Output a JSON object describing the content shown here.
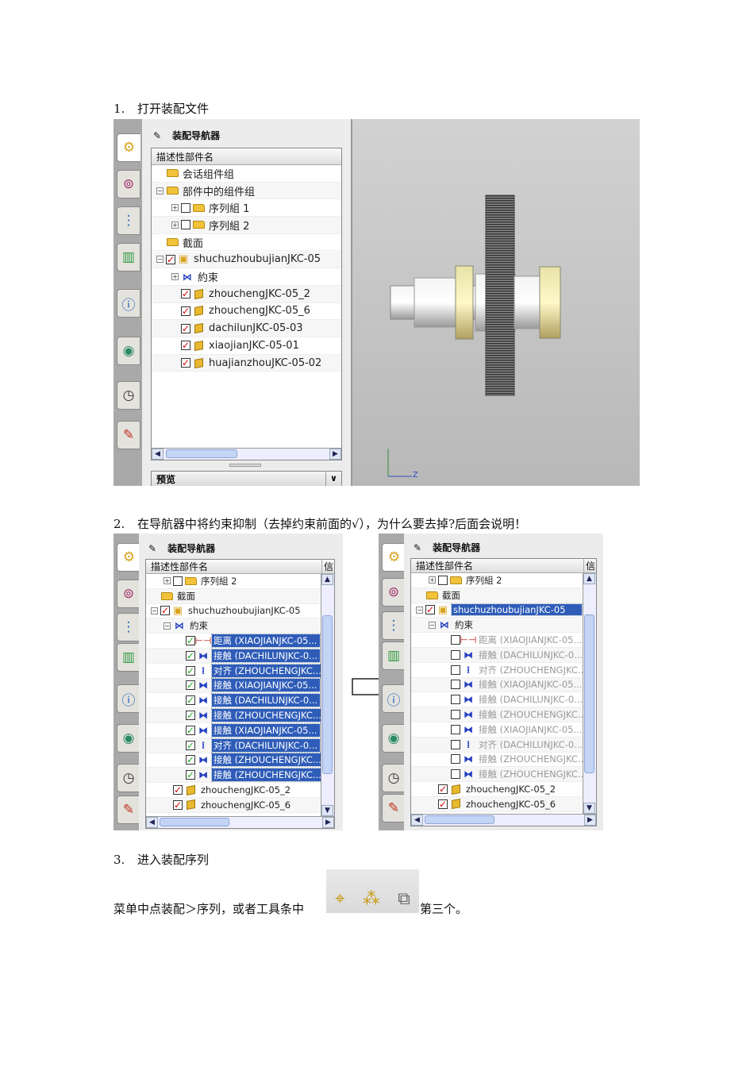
{
  "steps": [
    {
      "num": "1.",
      "text": "打开装配文件"
    },
    {
      "num": "2.",
      "text": "在导航器中将约束抑制（去掉约束前面的√），为什么要去掉?后面会说明！"
    },
    {
      "num": "3.",
      "text": "进入装配序列"
    }
  ],
  "line3": {
    "before": "菜单中点装配＞序列，或者工具条中",
    "after": "第三个。"
  },
  "colors": {
    "selection": "#2e5cb8",
    "check_red": "#dd0000",
    "check_green": "#22aa22",
    "viewport": "#c4c4c4"
  },
  "nav1": {
    "title": "装配导航器",
    "column": "描述性部件名",
    "preview": "预览",
    "axis_label": "Z",
    "rows": [
      {
        "level": 0,
        "exp": "",
        "check": "",
        "icon": "folder",
        "label": "会话组件组"
      },
      {
        "level": 0,
        "exp": "-",
        "check": "",
        "icon": "folder",
        "label": "部件中的组件组"
      },
      {
        "level": 1,
        "exp": "+",
        "check": "empty",
        "icon": "folder",
        "label": "序列組 1"
      },
      {
        "level": 1,
        "exp": "+",
        "check": "empty",
        "icon": "folder",
        "label": "序列組 2"
      },
      {
        "level": 0,
        "exp": "",
        "check": "",
        "icon": "folder",
        "label": "截面"
      },
      {
        "level": 0,
        "exp": "-",
        "check": "red",
        "icon": "assembly",
        "label": "shuchuzhoubujianJKC-05"
      },
      {
        "level": 1,
        "exp": "+",
        "check": "",
        "icon": "constraint",
        "label": "約束"
      },
      {
        "level": 1,
        "exp": "",
        "check": "red",
        "icon": "part",
        "label": "zhouchengJKC-05_2"
      },
      {
        "level": 1,
        "exp": "",
        "check": "red",
        "icon": "part",
        "label": "zhouchengJKC-05_6"
      },
      {
        "level": 1,
        "exp": "",
        "check": "red",
        "icon": "part",
        "label": "dachilunJKC-05-03"
      },
      {
        "level": 1,
        "exp": "",
        "check": "red",
        "icon": "part",
        "label": "xiaojianJKC-05-01"
      },
      {
        "level": 1,
        "exp": "",
        "check": "red",
        "icon": "part",
        "label": "huajianzhouJKC-05-02"
      }
    ]
  },
  "nav2": {
    "title": "装配导航器",
    "column": "描述性部件名",
    "column2": "信.",
    "rows": [
      {
        "level": 1,
        "exp": "+",
        "check": "empty",
        "icon": "folder",
        "label": "序列組 2"
      },
      {
        "level": 0,
        "exp": "",
        "check": "",
        "icon": "folder",
        "label": "截面"
      },
      {
        "level": 0,
        "exp": "-",
        "check": "red",
        "icon": "assembly",
        "label": "shuchuzhoubujianJKC-05"
      },
      {
        "level": 1,
        "exp": "-",
        "check": "",
        "icon": "constraint",
        "label": "約束"
      },
      {
        "level": 2,
        "exp": "",
        "check": "green",
        "icon": "dist",
        "label": "距离 (XIAOJIANJKC-05...",
        "sel": true
      },
      {
        "level": 2,
        "exp": "",
        "check": "green",
        "icon": "touch",
        "label": "接触 (DACHILUNJKC-0...",
        "sel": true
      },
      {
        "level": 2,
        "exp": "",
        "check": "green",
        "icon": "align",
        "label": "对齐 (ZHOUCHENGJKC...",
        "sel": true
      },
      {
        "level": 2,
        "exp": "",
        "check": "green",
        "icon": "touch",
        "label": "接触 (XIAOJIANJKC-05...",
        "sel": true
      },
      {
        "level": 2,
        "exp": "",
        "check": "green",
        "icon": "touch",
        "label": "接触 (DACHILUNJKC-0...",
        "sel": true
      },
      {
        "level": 2,
        "exp": "",
        "check": "green",
        "icon": "touch",
        "label": "接触 (ZHOUCHENGJKC...",
        "sel": true
      },
      {
        "level": 2,
        "exp": "",
        "check": "green",
        "icon": "touch",
        "label": "接触 (XIAOJIANJKC-05...",
        "sel": true
      },
      {
        "level": 2,
        "exp": "",
        "check": "green",
        "icon": "align",
        "label": "对齐 (DACHILUNJKC-0...",
        "sel": true
      },
      {
        "level": 2,
        "exp": "",
        "check": "green",
        "icon": "touch",
        "label": "接触 (ZHOUCHENGJKC...",
        "sel": true
      },
      {
        "level": 2,
        "exp": "",
        "check": "green",
        "icon": "touch",
        "label": "接触 (ZHOUCHENGJKC...",
        "sel": true
      },
      {
        "level": 1,
        "exp": "",
        "check": "red",
        "icon": "part",
        "label": "zhouchengJKC-05_2"
      },
      {
        "level": 1,
        "exp": "",
        "check": "red",
        "icon": "part",
        "label": "zhouchengJKC-05_6"
      }
    ]
  },
  "nav3": {
    "title": "装配导航器",
    "column": "描述性部件名",
    "column2": "信.",
    "rows": [
      {
        "level": 1,
        "exp": "+",
        "check": "empty",
        "icon": "folder",
        "label": "序列組 2"
      },
      {
        "level": 0,
        "exp": "",
        "check": "",
        "icon": "folder",
        "label": "截面"
      },
      {
        "level": 0,
        "exp": "-",
        "check": "red",
        "icon": "assembly",
        "label": "shuchuzhoubujianJKC-05",
        "sel": true
      },
      {
        "level": 1,
        "exp": "-",
        "check": "",
        "icon": "constraint",
        "label": "約束"
      },
      {
        "level": 2,
        "exp": "",
        "check": "empty",
        "icon": "dist",
        "label": "距离 (XIAOJIANJKC-05...",
        "dim": true
      },
      {
        "level": 2,
        "exp": "",
        "check": "empty",
        "icon": "touch",
        "label": "接触 (DACHILUNJKC-0...",
        "dim": true
      },
      {
        "level": 2,
        "exp": "",
        "check": "empty",
        "icon": "align",
        "label": "对齐 (ZHOUCHENGJKC...",
        "dim": true
      },
      {
        "level": 2,
        "exp": "",
        "check": "empty",
        "icon": "touch",
        "label": "接触 (XIAOJIANJKC-05...",
        "dim": true
      },
      {
        "level": 2,
        "exp": "",
        "check": "empty",
        "icon": "touch",
        "label": "接触 (DACHILUNJKC-0...",
        "dim": true
      },
      {
        "level": 2,
        "exp": "",
        "check": "empty",
        "icon": "touch",
        "label": "接触 (ZHOUCHENGJKC...",
        "dim": true
      },
      {
        "level": 2,
        "exp": "",
        "check": "empty",
        "icon": "touch",
        "label": "接触 (XIAOJIANJKC-05...",
        "dim": true
      },
      {
        "level": 2,
        "exp": "",
        "check": "empty",
        "icon": "align",
        "label": "对齐 (DACHILUNJKC-0...",
        "dim": true
      },
      {
        "level": 2,
        "exp": "",
        "check": "empty",
        "icon": "touch",
        "label": "接触 (ZHOUCHENGJKC...",
        "dim": true
      },
      {
        "level": 2,
        "exp": "",
        "check": "empty",
        "icon": "touch",
        "label": "接触 (ZHOUCHENGJKC...",
        "dim": true
      },
      {
        "level": 1,
        "exp": "",
        "check": "red",
        "icon": "part",
        "label": "zhouchengJKC-05_2"
      },
      {
        "level": 1,
        "exp": "",
        "check": "red",
        "icon": "part",
        "label": "zhouchengJKC-05_6"
      }
    ]
  }
}
